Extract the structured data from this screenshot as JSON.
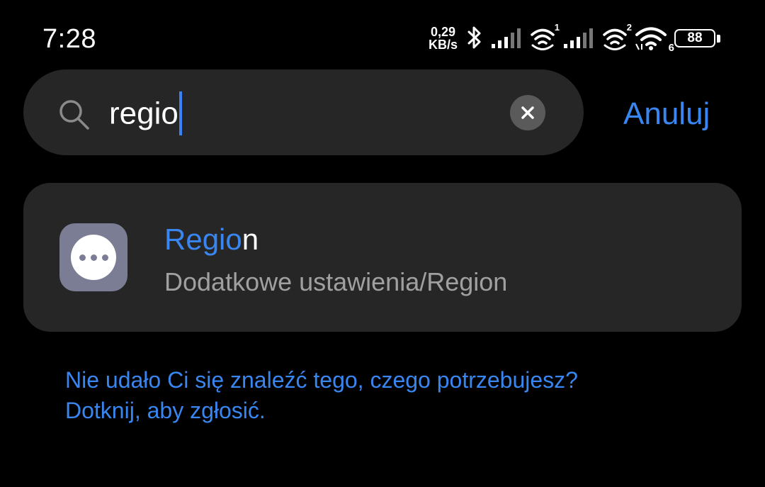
{
  "status_bar": {
    "time": "7:28",
    "speed_value": "0,29",
    "speed_unit": "KB/s",
    "sim1_label": "1",
    "sim2_label": "2",
    "wifi_label": "6",
    "battery": "88",
    "icons": [
      "bluetooth-icon",
      "signal-icon",
      "wifi-calling-icon",
      "signal-icon",
      "wifi-calling-icon",
      "wifi-icon",
      "battery-icon"
    ]
  },
  "search": {
    "query": "regio",
    "cancel_label": "Anuluj"
  },
  "result": {
    "title_match": "Regio",
    "title_rest": "n",
    "path": "Dodatkowe ustawienia/Region",
    "icon": "more-icon"
  },
  "feedback": {
    "line1": "Nie udało Ci się znaleźć tego, czego potrzebujesz?",
    "line2": "Dotknij, aby zgłosić."
  },
  "colors": {
    "background": "#000000",
    "surface": "#262626",
    "accent": "#3a86f0",
    "secondary_text": "#a0a0a0"
  }
}
